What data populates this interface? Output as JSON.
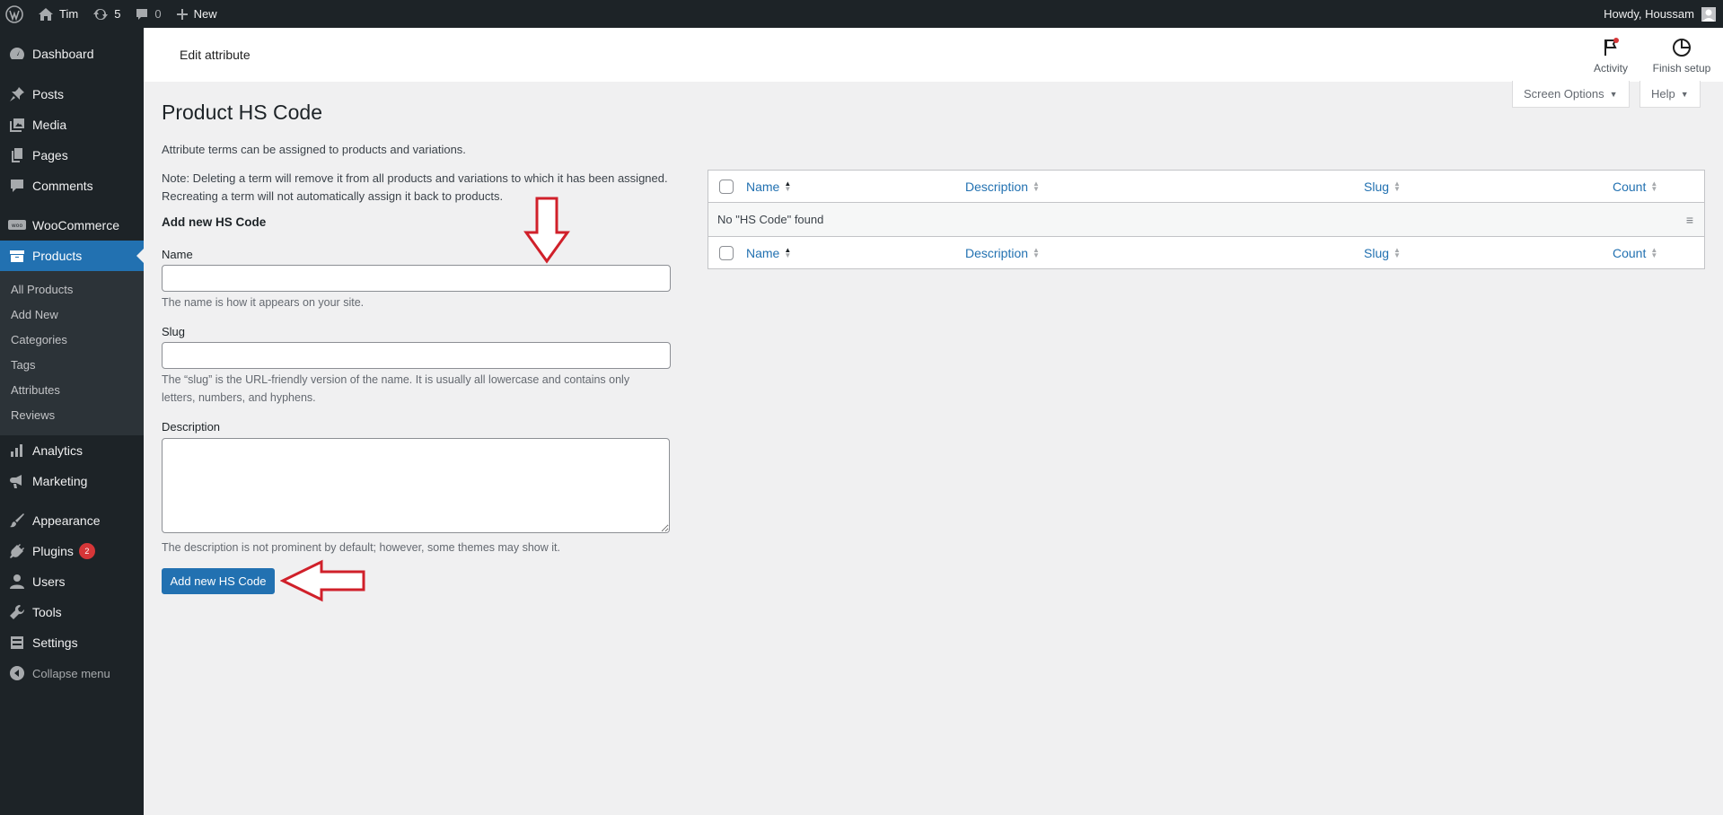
{
  "adminbar": {
    "site_name": "Tim",
    "updates_count": "5",
    "comments_count": "0",
    "new_label": "New",
    "howdy": "Howdy, Houssam"
  },
  "sidebar": {
    "items": [
      {
        "label": "Dashboard",
        "icon": "dashboard-icon"
      },
      {
        "label": "Posts",
        "icon": "pin-icon"
      },
      {
        "label": "Media",
        "icon": "media-icon"
      },
      {
        "label": "Pages",
        "icon": "pages-icon"
      },
      {
        "label": "Comments",
        "icon": "comments-icon"
      },
      {
        "label": "WooCommerce",
        "icon": "woo-icon"
      },
      {
        "label": "Products",
        "icon": "products-icon"
      },
      {
        "label": "Analytics",
        "icon": "analytics-icon"
      },
      {
        "label": "Marketing",
        "icon": "megaphone-icon"
      },
      {
        "label": "Appearance",
        "icon": "brush-icon"
      },
      {
        "label": "Plugins",
        "icon": "plug-icon",
        "badge": "2"
      },
      {
        "label": "Users",
        "icon": "user-icon"
      },
      {
        "label": "Tools",
        "icon": "wrench-icon"
      },
      {
        "label": "Settings",
        "icon": "settings-icon"
      }
    ],
    "submenu": [
      "All Products",
      "Add New",
      "Categories",
      "Tags",
      "Attributes",
      "Reviews"
    ],
    "collapse": "Collapse menu"
  },
  "header": {
    "title": "Edit attribute",
    "activity": "Activity",
    "finish_setup": "Finish setup"
  },
  "screen_options": "Screen Options",
  "help": "Help",
  "page": {
    "title": "Product HS Code",
    "intro": "Attribute terms can be assigned to products and variations.",
    "note_line1": "Note: Deleting a term will remove it from all products and variations to which it has been assigned.",
    "note_line2": "Recreating a term will not automatically assign it back to products."
  },
  "form": {
    "heading": "Add new HS Code",
    "name_label": "Name",
    "name_help": "The name is how it appears on your site.",
    "slug_label": "Slug",
    "slug_help_line1": "The “slug” is the URL-friendly version of the name. It is usually all lowercase and contains only",
    "slug_help_line2": "letters, numbers, and hyphens.",
    "description_label": "Description",
    "description_help": "The description is not prominent by default; however, some themes may show it.",
    "submit": "Add new HS Code"
  },
  "table": {
    "columns": [
      "Name",
      "Description",
      "Slug",
      "Count"
    ],
    "empty_message": "No \"HS Code\" found"
  },
  "colors": {
    "admin_dark": "#1d2327",
    "accent": "#2271b1",
    "annotation": "#d0202a"
  }
}
